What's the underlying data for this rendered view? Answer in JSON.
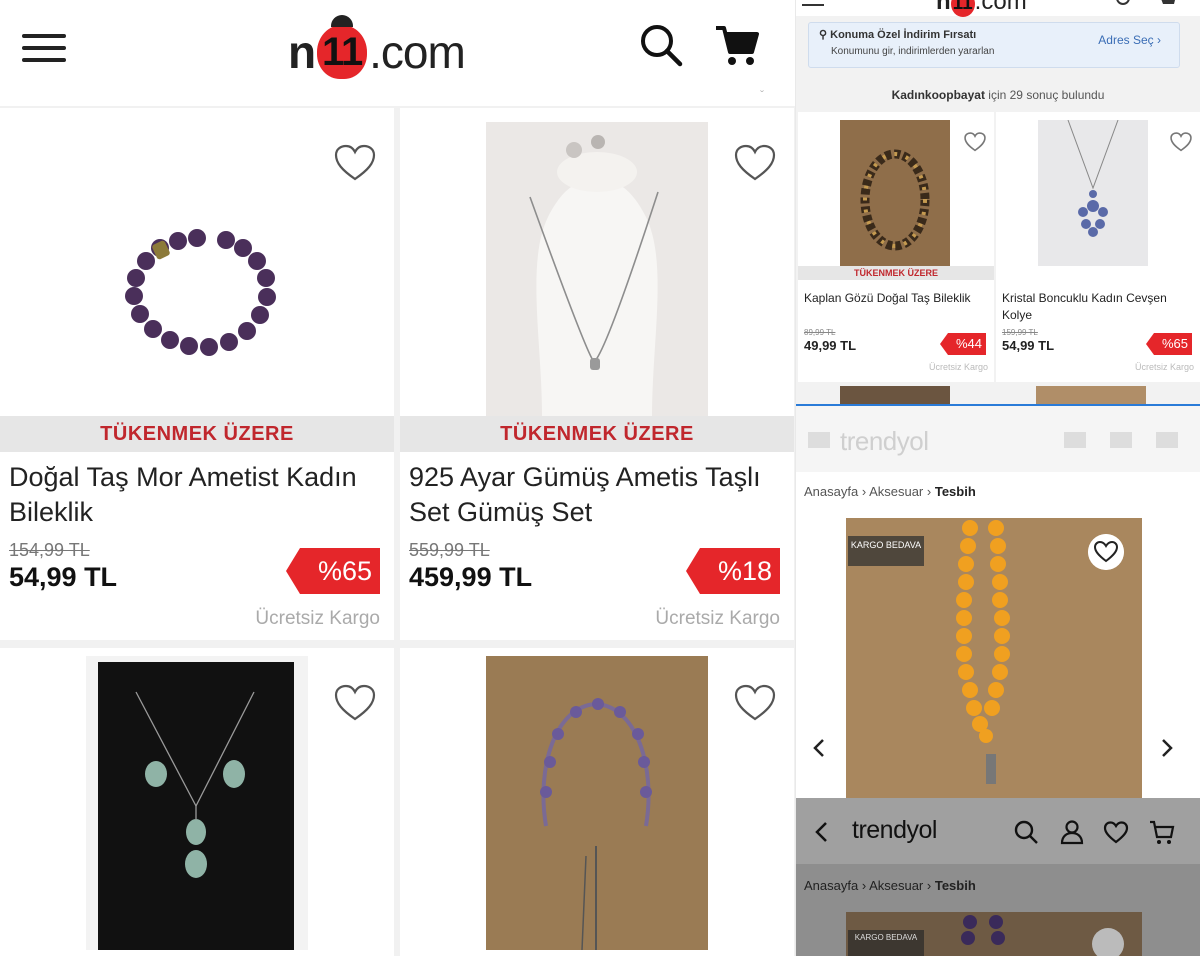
{
  "left": {
    "logo": {
      "prefix": "n",
      "bug": "11",
      "suffix": ".com"
    },
    "products": [
      {
        "stock_label": "TÜKENMEK ÜZERE",
        "title": "Doğal Taş Mor Ametist Kadın Bileklik",
        "old_price": "154,99 TL",
        "price": "54,99 TL",
        "discount": "%65",
        "cargo": "Ücretsiz Kargo"
      },
      {
        "stock_label": "TÜKENMEK ÜZERE",
        "title": "925 Ayar Gümüş Ametis Taşlı Set Gümüş Set",
        "old_price": "559,99 TL",
        "price": "459,99 TL",
        "discount": "%18",
        "cargo": "Ücretsiz Kargo"
      }
    ]
  },
  "search_panel": {
    "logo": {
      "bug": "11",
      "suffix": ".com"
    },
    "location_title": "Konuma Özel İndirim Fırsatı",
    "location_sub": "Konumunu gir, indirimlerden yararlan",
    "location_link": "Adres Seç",
    "result_query": "Kadınkoopbayat",
    "result_text": "için 29 sonuç bulundu",
    "products": [
      {
        "stock_label": "TÜKENMEK ÜZERE",
        "title": "Kaplan Gözü Doğal Taş Bileklik",
        "old_price": "89,99 TL",
        "price": "49,99 TL",
        "discount": "%44",
        "cargo": "Ücretsiz Kargo"
      },
      {
        "stock_label": "",
        "title": "Kristal Boncuklu Kadın Cevşen Kolye",
        "old_price": "159,99 TL",
        "price": "54,99 TL",
        "discount": "%65",
        "cargo": "Ücretsiz Kargo"
      }
    ]
  },
  "trendyol_mid": {
    "logo": "trendyol",
    "breadcrumb": [
      "Anasayfa",
      "Aksesuar",
      "Tesbih"
    ],
    "kargo_tag": "KARGO BEDAVA"
  },
  "trendyol_bottom": {
    "logo": "trendyol",
    "breadcrumb": [
      "Anasayfa",
      "Aksesuar",
      "Tesbih"
    ],
    "kargo_tag": "KARGO BEDAVA"
  },
  "colors": {
    "n11_red": "#e5262a",
    "stock_red": "#c0272d",
    "link_blue": "#3a6db5"
  }
}
